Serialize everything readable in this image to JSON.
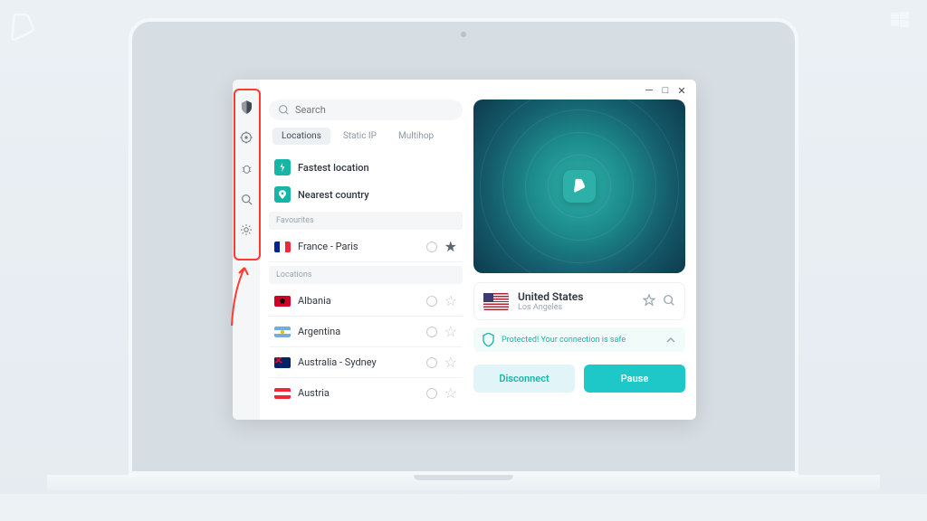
{
  "search": {
    "placeholder": "Search"
  },
  "tabs": {
    "locations": "Locations",
    "static_ip": "Static IP",
    "multihop": "Multihop"
  },
  "quick": {
    "fastest": "Fastest location",
    "nearest": "Nearest country"
  },
  "sections": {
    "favourites": "Favourites",
    "locations": "Locations"
  },
  "favourites": [
    {
      "label": "France - Paris",
      "flag": "fr"
    }
  ],
  "locations": [
    {
      "label": "Albania",
      "flag": "al"
    },
    {
      "label": "Argentina",
      "flag": "ar"
    },
    {
      "label": "Australia - Sydney",
      "flag": "au"
    },
    {
      "label": "Austria",
      "flag": "at"
    }
  ],
  "connection": {
    "country": "United States",
    "city": "Los Angeles",
    "status": "Protected! Your connection is safe"
  },
  "actions": {
    "disconnect": "Disconnect",
    "pause": "Pause"
  },
  "colors": {
    "accent": "#17b5a6",
    "highlight": "#ff3b30"
  }
}
